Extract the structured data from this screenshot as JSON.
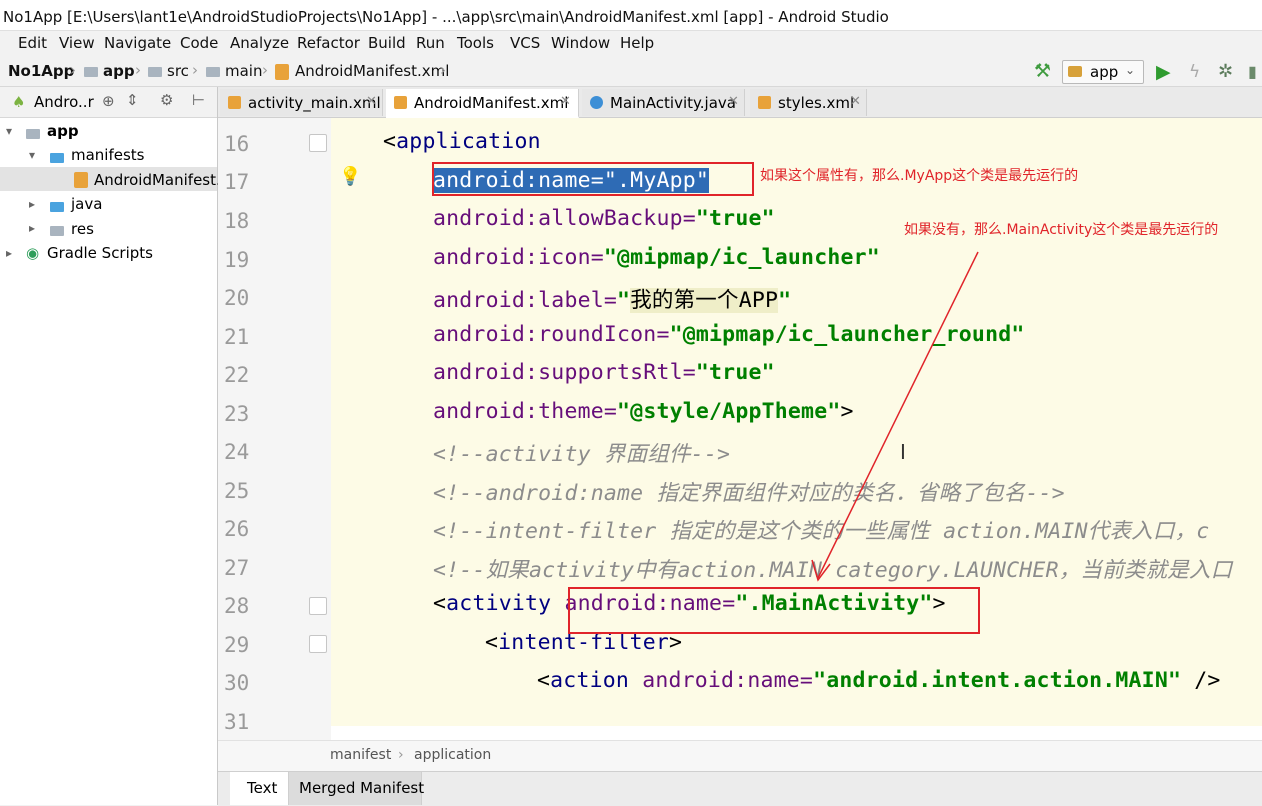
{
  "window": {
    "title": "No1App [E:\\Users\\lant1e\\AndroidStudioProjects\\No1App] - ...\\app\\src\\main\\AndroidManifest.xml [app] - Android Studio"
  },
  "menu": [
    "Edit",
    "View",
    "Navigate",
    "Code",
    "Analyze",
    "Refactor",
    "Build",
    "Run",
    "Tools",
    "VCS",
    "Window",
    "Help"
  ],
  "nav": {
    "crumbs": [
      "No1App",
      "app",
      "src",
      "main",
      "AndroidManifest.xml"
    ],
    "run_config": "app"
  },
  "project_panel": {
    "header": "Andro..r",
    "tree": [
      "app",
      "manifests",
      "AndroidManifest.x",
      "java",
      "res",
      "Gradle Scripts"
    ]
  },
  "tabs": [
    "activity_main.xml",
    "AndroidManifest.xml",
    "MainActivity.java",
    "styles.xml"
  ],
  "editor": {
    "line_numbers": [
      "16",
      "17",
      "18",
      "19",
      "20",
      "21",
      "22",
      "23",
      "24",
      "25",
      "26",
      "27",
      "28",
      "29",
      "30",
      "31"
    ],
    "l16": {
      "lt": "<",
      "tag": "application"
    },
    "l17": {
      "ns": "android",
      "attr": ":name=",
      "val": "\".MyApp\""
    },
    "l18": {
      "ns": "android",
      "attr": ":allowBackup=",
      "val": "\"true\""
    },
    "l19": {
      "ns": "android",
      "attr": ":icon=",
      "val": "\"@mipmap/ic_launcher\""
    },
    "l20": {
      "ns": "android",
      "attr": ":label=",
      "val_q": "\"",
      "val": "我的第一个APP",
      "val_q2": "\""
    },
    "l21": {
      "ns": "android",
      "attr": ":roundIcon=",
      "val": "\"@mipmap/ic_launcher_round\""
    },
    "l22": {
      "ns": "android",
      "attr": ":supportsRtl=",
      "val": "\"true\""
    },
    "l23": {
      "ns": "android",
      "attr": ":theme=",
      "val": "\"@style/AppTheme\"",
      "end": ">"
    },
    "l24": "<!--activity 界面组件-->",
    "l25": "<!--android:name 指定界面组件对应的类名．省略了包名-->",
    "l26": "<!--intent-filter 指定的是这个类的一些属性 action.MAIN代表入口，c",
    "l27": "<!--如果activity中有action.MAIN category.LAUNCHER，当前类就是入口",
    "l28": {
      "lt": "<",
      "tag": "activity",
      "ns": "android",
      "attr": ":name=",
      "val": "\".MainActivity\"",
      "end": ">"
    },
    "l29": {
      "lt": "<",
      "tag": "intent-filter",
      "end": ">"
    },
    "l30": {
      "lt": "<",
      "tag": "action",
      "ns": "android",
      "attr": ":name=",
      "val": "\"android.intent.action.MAIN\"",
      "end": " />"
    }
  },
  "breadcrumb": [
    "manifest",
    "application"
  ],
  "bottom_tabs": [
    "Text",
    "Merged Manifest"
  ],
  "annotations": {
    "first": "如果这个属性有，那么.MyApp这个类是最先运行的",
    "second": "如果没有，那么.MainActivity这个类是最先运行的"
  },
  "colors": {
    "annotation_red": "#e0242a",
    "editor_bg": "#fdfbe6",
    "selection": "#2e6bb5"
  }
}
